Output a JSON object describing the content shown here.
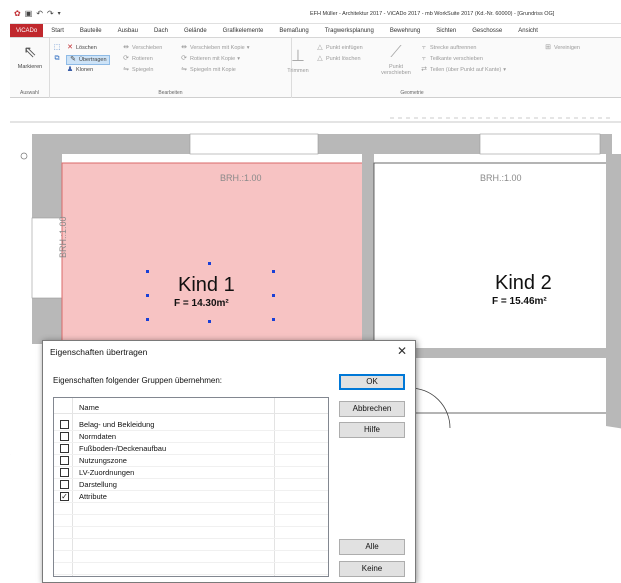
{
  "window": {
    "title": "EFH Müller - Architektur 2017 - ViCADo 2017 - mb WorkSuite 2017 (Kd.-Nr. 60000) - [Grundriss OG]"
  },
  "ribbon_tabs": [
    {
      "label": "ViCADo"
    },
    {
      "label": "Start"
    },
    {
      "label": "Bauteile"
    },
    {
      "label": "Ausbau"
    },
    {
      "label": "Dach"
    },
    {
      "label": "Gelände"
    },
    {
      "label": "Grafikelemente"
    },
    {
      "label": "Bemaßung"
    },
    {
      "label": "Tragwerksplanung"
    },
    {
      "label": "Bewehrung"
    },
    {
      "label": "Sichten"
    },
    {
      "label": "Geschosse"
    },
    {
      "label": "Ansicht"
    }
  ],
  "ribbon": {
    "auswahl": {
      "markieren": "Markieren",
      "group": "Auswahl"
    },
    "bearbeiten": {
      "loeschen": "Löschen",
      "uebertragen": "Übertragen",
      "klonen": "Klonen",
      "verschieben": "Verschieben",
      "rotieren": "Rotieren",
      "spiegeln": "Spiegeln",
      "verschieben_kopie": "Verschieben mit Kopie",
      "rotieren_kopie": "Rotieren mit Kopie",
      "spiegeln_kopie": "Spiegeln mit Kopie",
      "group": "Bearbeiten"
    },
    "geometrie": {
      "trimmen": "Trimmen",
      "punkt_einfuegen": "Punkt einfügen",
      "punkt_loeschen": "Punkt löschen",
      "punkt_verschieben_1": "Punkt",
      "punkt_verschieben_2": "verschieben",
      "strecke_auftrennen": "Strecke auftrennen",
      "teilkante_verschieben": "Teilkante verschieben",
      "teilen": "Teilen (über Punkt auf Kante)",
      "vereinigen": "Vereinigen",
      "group": "Geometrie"
    }
  },
  "drawing": {
    "rooms": [
      {
        "name": "Kind 1",
        "area": "F = 14.30m²",
        "brh_top": "BRH.:1.00",
        "brh_side": "BRH.:1.00",
        "fill": "#f7c3c3"
      },
      {
        "name": "Kind 2",
        "area": "F = 15.46m²",
        "brh_top": "BRH.:1.00"
      }
    ]
  },
  "dialog": {
    "title": "Eigenschaften übertragen",
    "caption": "Eigenschaften folgender Gruppen übernehmen:",
    "buttons": {
      "ok": "OK",
      "cancel": "Abbrechen",
      "help": "Hilfe",
      "all": "Alle",
      "none": "Keine"
    },
    "column_header": "Name",
    "items": [
      {
        "label": "Belag- und Bekleidung",
        "checked": false
      },
      {
        "label": "Normdaten",
        "checked": false
      },
      {
        "label": "Fußboden-/Deckenaufbau",
        "checked": false
      },
      {
        "label": "Nutzungszone",
        "checked": false
      },
      {
        "label": "LV-Zuordnungen",
        "checked": false
      },
      {
        "label": "Darstellung",
        "checked": false
      },
      {
        "label": "Attribute",
        "checked": true
      }
    ]
  },
  "colors": {
    "accent": "#c0282d",
    "selection": "#0078d7",
    "room_highlight": "#f7c3c3",
    "wall": "#b8b8b8"
  }
}
